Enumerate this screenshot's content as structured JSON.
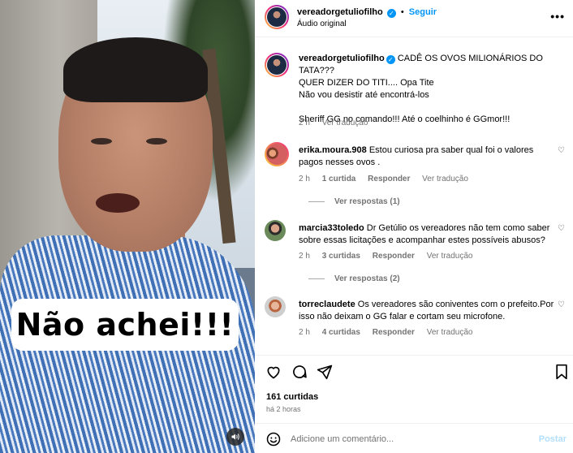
{
  "post": {
    "author": "vereadorgetuliofilho",
    "follow_label": "Seguir",
    "audio_label": "Áudio original",
    "caption_lines": [
      "CADÊ OS OVOS MILIONÁRIOS DO TATA???",
      "QUER DIZER DO TITI.... Opa Tite",
      "Não vou desistir até encontrá-los",
      "Sheriff GG no comando!!! Até o coelhinho é GGmor!!!"
    ],
    "caption_time": "2 h",
    "caption_translate": "Ver tradução",
    "video_overlay_text": "Não achei!!!",
    "likes": "161 curtidas",
    "time_ago": "há 2 horas"
  },
  "comments": [
    {
      "user": "erika.moura.908",
      "text": "Estou curiosa pra saber qual foi o valores pagos nesses ovos .",
      "time": "2 h",
      "likes": "1 curtida",
      "reply": "Responder",
      "translate": "Ver tradução",
      "replies": "Ver respostas (1)"
    },
    {
      "user": "marcia33toledo",
      "text": "Dr Getúlio os vereadores não tem como saber sobre essas licitações e acompanhar estes possíveis abusos?",
      "time": "2 h",
      "likes": "3 curtidas",
      "reply": "Responder",
      "translate": "Ver tradução",
      "replies": "Ver respostas (2)"
    },
    {
      "user": "torreclaudete",
      "text": "Os vereadores são coniventes com o prefeito.Por isso não deixam o GG falar e cortam seu microfone.",
      "time": "2 h",
      "likes": "4 curtidas",
      "reply": "Responder",
      "translate": "Ver tradução",
      "replies": ""
    }
  ],
  "add_comment": {
    "placeholder": "Adicione um comentário...",
    "post_label": "Postar"
  },
  "icons": [
    "more-icon",
    "verified-icon",
    "heart-icon",
    "comment-icon",
    "share-icon",
    "bookmark-icon",
    "emoji-icon",
    "audio-icon"
  ],
  "colors": {
    "accent": "#0095f6",
    "muted": "#737373",
    "post_disabled": "#b2dffc"
  }
}
